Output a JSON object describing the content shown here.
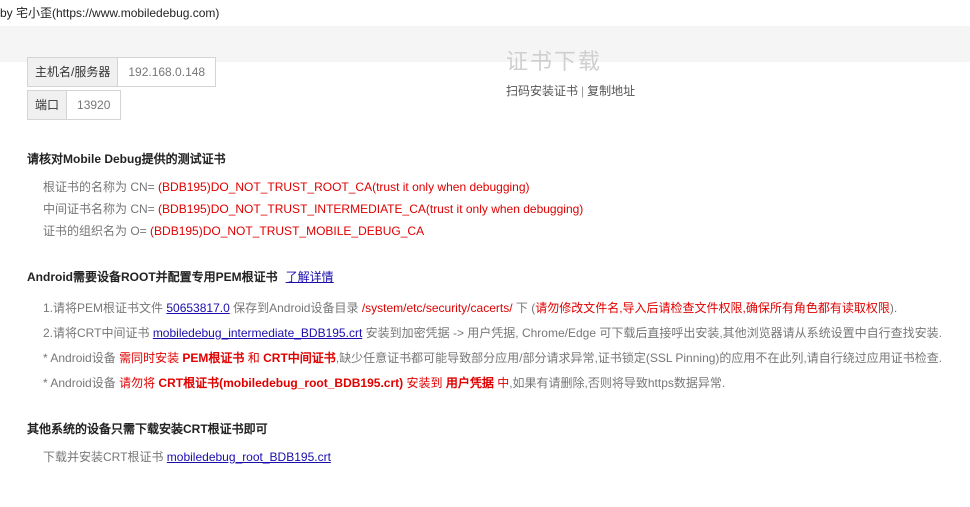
{
  "credit": "by 宅小歪(https://www.mobiledebug.com)",
  "server": {
    "host_label": "主机名/服务器",
    "host_value": "192.168.0.148",
    "port_label": "端口",
    "port_value": "13920"
  },
  "qr": {
    "title": "证书下载",
    "scan_link": "扫码安装证书",
    "separator": "|",
    "copy_link": "复制地址"
  },
  "verify": {
    "heading": "请核对Mobile Debug提供的测试证书",
    "lines": [
      {
        "label": "根证书的名称为 CN=",
        "value": "(BDB195)DO_NOT_TRUST_ROOT_CA(trust it only when debugging)"
      },
      {
        "label": "中间证书名称为 CN=",
        "value": "(BDB195)DO_NOT_TRUST_INTERMEDIATE_CA(trust it only when debugging)"
      },
      {
        "label": "证书的组织名为 O=",
        "value": "(BDB195)DO_NOT_TRUST_MOBILE_DEBUG_CA"
      }
    ]
  },
  "android": {
    "heading": "Android需要设备ROOT并配置专用PEM根证书",
    "more_link": "了解详情",
    "step1": {
      "prefix": "1.请将PEM根证书文件",
      "file": "50653817.0",
      "mid": "保存到Android设备目录",
      "path": "/system/etc/security/cacerts/",
      "mid2": "下 (",
      "warn": "请勿修改文件名,导入后请检查文件权限,确保所有角色都有读取权限",
      "suffix": ")."
    },
    "step2": {
      "prefix": "2.请将CRT中间证书",
      "file": "mobiledebug_intermediate_BDB195.crt",
      "suffix": "安装到加密凭据 -> 用户凭据, Chrome/Edge 可下载后直接呼出安装,其他浏览器请从系统设置中自行查找安装."
    },
    "note1": {
      "prefix": "* Android设备",
      "r1": "需同时安装",
      "b1": "PEM根证书",
      "r2": "和",
      "b2": "CRT中间证书",
      "suffix": ",缺少任意证书都可能导致部分应用/部分请求异常,证书锁定(SSL Pinning)的应用不在此列,请自行绕过应用证书检查."
    },
    "note2": {
      "prefix": "* Android设备",
      "r1": "请勿将",
      "b1": "CRT根证书(mobiledebug_root_BDB195.crt)",
      "r2": "安装到",
      "b2": "用户凭据",
      "r3": "中",
      "suffix": ",如果有请删除,否则将导致https数据异常."
    }
  },
  "other": {
    "heading": "其他系统的设备只需下载安装CRT根证书即可",
    "prefix": "下载并安装CRT根证书",
    "file": "mobiledebug_root_BDB195.crt"
  },
  "colors": {
    "accent_red": "#e00000",
    "link_blue": "#1a0dab"
  }
}
